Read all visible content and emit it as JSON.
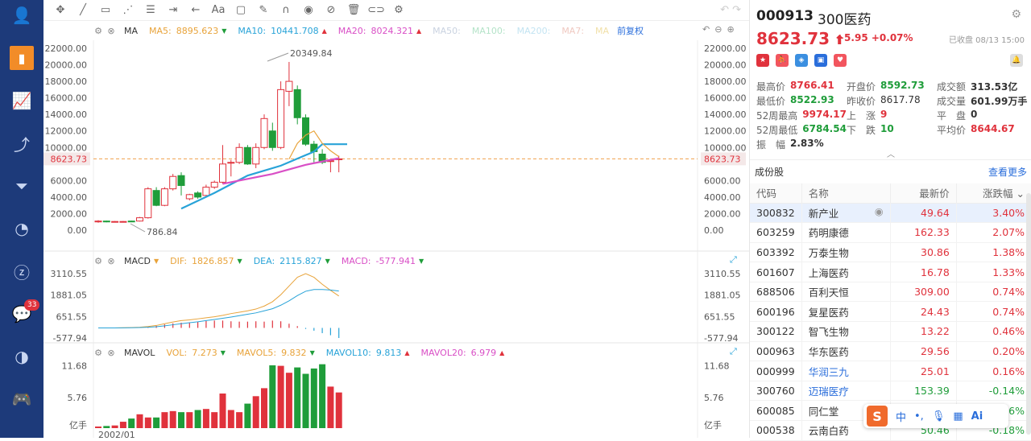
{
  "nav": {
    "icons": [
      "user-icon",
      "bar-chart-icon",
      "line-chart-icon",
      "trend-icon",
      "filter-icon",
      "pie-chart-icon",
      "zhihu-icon",
      "chat-icon",
      "moon-icon",
      "gamepad-icon"
    ],
    "badge": "33"
  },
  "toolbar": {
    "icons": [
      "move-icon",
      "draw-line-icon",
      "rect-icon",
      "polyline-icon",
      "fib-icon",
      "measure-icon",
      "arrow-icon",
      "text-icon",
      "comment-icon",
      "pen-icon",
      "magnet-icon",
      "eye-icon",
      "hide-icon",
      "trash-icon",
      "toggle-icon",
      "settings-icon"
    ],
    "text_tool": "Aa"
  },
  "ma_legend": {
    "name": "MA",
    "ma5_label": "MA5:",
    "ma5": "8895.623",
    "ma10_label": "MA10:",
    "ma10": "10441.708",
    "ma20_label": "MA20:",
    "ma20": "8024.321",
    "ma50_label": "MA50:",
    "ma100_label": "MA100:",
    "ma200_label": "MA200:",
    "ma7_label": "MA7:",
    "ma_more": "MA",
    "fq": "前复权"
  },
  "macd_legend": {
    "name": "MACD",
    "dif_label": "DIF:",
    "dif": "1826.857",
    "dea_label": "DEA:",
    "dea": "2115.827",
    "macd_label": "MACD:",
    "macd": "-577.941"
  },
  "vol_legend": {
    "name": "MAVOL",
    "vol_label": "VOL:",
    "vol": "7.273",
    "v5_label": "MAVOL5:",
    "v5": "9.832",
    "v10_label": "MAVOL10:",
    "v10": "9.813",
    "v20_label": "MAVOL20:",
    "v20": "6.979"
  },
  "chart_data": {
    "type": "candlestick",
    "y_ticks": [
      "22000.00",
      "20000.00",
      "18000.00",
      "16000.00",
      "14000.00",
      "12000.00",
      "10000.00",
      "8623.73",
      "6000.00",
      "4000.00",
      "2000.00",
      "0.00"
    ],
    "high_label": "20349.84",
    "low_label": "786.84",
    "current": "8623.73",
    "macd_ticks": [
      "3110.55",
      "1881.05",
      "651.55",
      "-577.94"
    ],
    "vol_ticks": [
      "11.68",
      "5.76"
    ],
    "vol_unit": "亿手",
    "x_label": "2002/01",
    "candles": [
      [
        1000,
        1100,
        900,
        1200
      ],
      [
        1100,
        1000,
        950,
        1150
      ],
      [
        1000,
        1050,
        950,
        1100
      ],
      [
        1000,
        1050,
        950,
        1100
      ],
      [
        1100,
        1000,
        980,
        1150
      ],
      [
        1100,
        1500,
        1050,
        1600
      ],
      [
        1500,
        5000,
        1400,
        5200
      ],
      [
        4800,
        3000,
        2900,
        5200
      ],
      [
        3000,
        5000,
        2900,
        5200
      ],
      [
        5000,
        6500,
        4800,
        6800
      ],
      [
        6600,
        5400,
        4200,
        7000
      ],
      [
        3800,
        4300,
        3600,
        4400
      ],
      [
        4500,
        4000,
        3800,
        4700
      ],
      [
        4200,
        5200,
        4000,
        5500
      ],
      [
        5200,
        5800,
        5000,
        6000
      ],
      [
        5800,
        8000,
        5600,
        10300
      ],
      [
        8200,
        8200,
        6500,
        8500
      ],
      [
        8200,
        10000,
        8000,
        10500
      ],
      [
        10000,
        8000,
        7900,
        10300
      ],
      [
        8000,
        10000,
        7500,
        10500
      ],
      [
        10000,
        13500,
        9800,
        14000
      ],
      [
        12000,
        10000,
        9600,
        13000
      ],
      [
        10000,
        17000,
        9800,
        18000
      ],
      [
        16800,
        18000,
        15000,
        20349
      ],
      [
        17000,
        13600,
        12800,
        17500
      ],
      [
        13600,
        10400,
        10200,
        14000
      ],
      [
        10400,
        9500,
        8200,
        10800
      ],
      [
        9200,
        8200,
        8000,
        9800
      ],
      [
        8300,
        8400,
        7000,
        8600
      ],
      [
        8600,
        8623,
        7000,
        9000
      ]
    ],
    "vol": [
      0.3,
      0.4,
      0.5,
      1.2,
      1.8,
      2.6,
      2.0,
      2.0,
      3.0,
      3.2,
      3.0,
      3.0,
      3.4,
      3.6,
      3.0,
      6.5,
      3.4,
      3.0,
      4.6,
      6.0,
      7.5,
      11.8,
      11.7,
      10.4,
      11.4,
      10.2,
      11.2,
      12.0,
      7.8,
      6.7
    ],
    "macd": [
      0,
      0,
      0,
      0,
      10,
      20,
      60,
      120,
      200,
      260,
      300,
      320,
      360,
      400,
      420,
      420,
      380,
      360,
      360,
      380,
      360,
      420,
      380,
      240,
      100,
      -60,
      -160,
      -300,
      -420,
      -578
    ],
    "dif": [
      0,
      0,
      0,
      10,
      20,
      40,
      80,
      140,
      240,
      340,
      420,
      460,
      520,
      580,
      640,
      720,
      820,
      900,
      980,
      1080,
      1250,
      1500,
      1900,
      2400,
      2900,
      3110,
      2900,
      2500,
      2150,
      1827
    ],
    "dea": [
      0,
      0,
      0,
      5,
      10,
      20,
      40,
      70,
      120,
      180,
      240,
      300,
      350,
      420,
      480,
      550,
      620,
      700,
      780,
      860,
      980,
      1100,
      1300,
      1550,
      1850,
      2100,
      2200,
      2200,
      2170,
      2116
    ],
    "ma5_points": [
      [
        0,
        8600
      ],
      [
        1,
        10500
      ],
      [
        2,
        11500
      ],
      [
        3,
        12000
      ],
      [
        4,
        10500
      ],
      [
        5,
        9600
      ],
      [
        6,
        8900
      ]
    ],
    "ma10_points": [
      [
        0,
        2600
      ],
      [
        4,
        4500
      ],
      [
        8,
        6600
      ],
      [
        12,
        7800
      ],
      [
        16,
        9500
      ],
      [
        17,
        10400
      ],
      [
        20,
        10400
      ]
    ],
    "ma20_points": [
      [
        0,
        5600
      ],
      [
        6,
        6800
      ],
      [
        10,
        7900
      ],
      [
        14,
        8700
      ]
    ]
  },
  "panel": {
    "code": "000913",
    "name": "300医药",
    "price": "8623.73",
    "change": "+5.95",
    "pct": "+0.07%",
    "status": "已收盘 08/13 15:00",
    "flags": [
      {
        "icon": "flag-cn-icon",
        "color": "#e0323c",
        "t": "★"
      },
      {
        "icon": "runner-icon",
        "color": "#f2555e",
        "t": "⛹"
      },
      {
        "icon": "tag-icon",
        "color": "#3b8fe0",
        "t": "◈"
      },
      {
        "icon": "book-icon",
        "color": "#2a6edb",
        "t": "▣"
      },
      {
        "icon": "heart-icon",
        "color": "#f2555e",
        "t": "♥"
      }
    ],
    "stats": [
      [
        [
          "最高价",
          "8766.41",
          "red"
        ],
        [
          "开盘价",
          "8592.73",
          "grn"
        ],
        [
          "成交额",
          "313.53亿",
          "blk"
        ]
      ],
      [
        [
          "最低价",
          "8522.93",
          "grn"
        ],
        [
          "昨收价",
          "8617.78",
          ""
        ],
        [
          "成交量",
          "601.99万手",
          "blk"
        ]
      ],
      [
        [
          "52周最高",
          "9974.17",
          "red"
        ],
        [
          "上　涨",
          "9",
          "red"
        ],
        [
          "平　盘",
          "0",
          "blk"
        ]
      ],
      [
        [
          "52周最低",
          "6784.54",
          "grn"
        ],
        [
          "下　跌",
          "10",
          "grn"
        ],
        [
          "平均价",
          "8644.67",
          "red"
        ]
      ],
      [
        [
          "振　幅",
          "2.83%",
          "blk"
        ]
      ]
    ],
    "section": "成份股",
    "more": "查看更多",
    "headers": [
      "代码",
      "名称",
      "最新价",
      "涨跌幅"
    ],
    "rows": [
      [
        "300832",
        "新产业",
        "49.64",
        "3.40%"
      ],
      [
        "603259",
        "药明康德",
        "162.33",
        "2.07%"
      ],
      [
        "603392",
        "万泰生物",
        "30.86",
        "1.38%"
      ],
      [
        "601607",
        "上海医药",
        "16.78",
        "1.33%"
      ],
      [
        "688506",
        "百利天恒",
        "309.00",
        "0.74%"
      ],
      [
        "600196",
        "复星医药",
        "24.43",
        "0.74%"
      ],
      [
        "300122",
        "智飞生物",
        "13.22",
        "0.46%"
      ],
      [
        "000963",
        "华东医药",
        "29.56",
        "0.20%"
      ],
      [
        "000999",
        "华润三九",
        "25.01",
        "0.16%"
      ],
      [
        "300760",
        "迈瑞医疗",
        "153.39",
        "-0.14%"
      ],
      [
        "600085",
        "同仁堂",
        "",
        "-0.16%"
      ],
      [
        "000538",
        "云南白药",
        "50.46",
        "-0.18%"
      ]
    ]
  },
  "ime": {
    "logo": "S",
    "cn": "中",
    "punct": "•,",
    "mic": "🎙",
    "kb": "▦",
    "ai": "Ai"
  }
}
